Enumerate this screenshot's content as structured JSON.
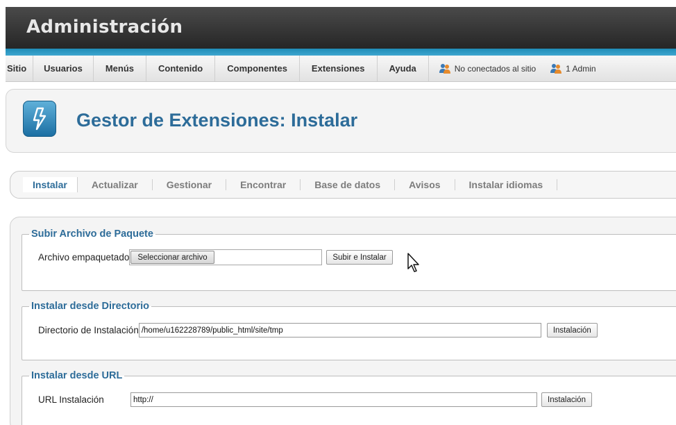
{
  "header": {
    "title": "Administración"
  },
  "menu": {
    "items": [
      "Sitio",
      "Usuarios",
      "Menús",
      "Contenido",
      "Componentes",
      "Extensiones",
      "Ayuda"
    ],
    "status_offline": "No conectados al sitio",
    "status_admin": "1 Admin"
  },
  "page": {
    "title": "Gestor de Extensiones: Instalar",
    "icon": "extension-lightning-icon"
  },
  "tabs": [
    "Instalar",
    "Actualizar",
    "Gestionar",
    "Encontrar",
    "Base de datos",
    "Avisos",
    "Instalar idiomas"
  ],
  "upload": {
    "legend": "Subir Archivo de Paquete",
    "label": "Archivo empaquetado",
    "file_button": "Seleccionar archivo",
    "submit": "Subir e Instalar"
  },
  "directory": {
    "legend": "Instalar desde Directorio",
    "label": "Directorio de Instalación",
    "value": "/home/u162228789/public_html/site/tmp",
    "submit": "Instalación"
  },
  "url": {
    "legend": "Instalar desde URL",
    "label": "URL Instalación",
    "value": "http://",
    "submit": "Instalación"
  },
  "colors": {
    "accent": "#2d6c99",
    "stripe": "#2a9bc6",
    "header_bg": "#333333"
  }
}
